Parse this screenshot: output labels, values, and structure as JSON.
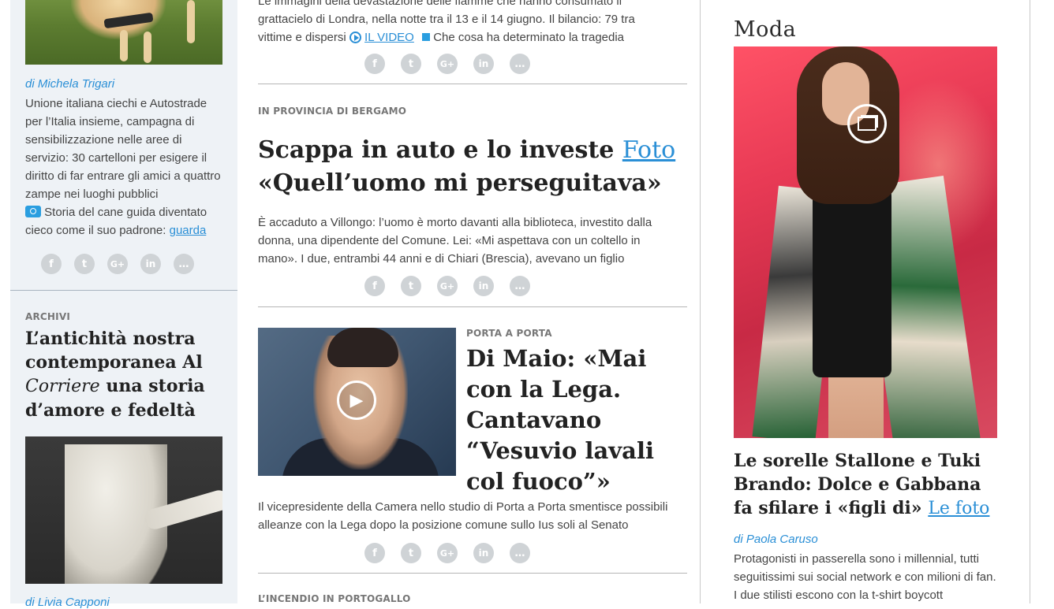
{
  "left": {
    "article1": {
      "byline_prefix": "di",
      "byline_name": "Michela Trigari",
      "body": "Unione italiana ciechi e Autostrade per l’Italia insieme, campagna di sensibilizzazione nelle aree di servizio: 30 cartelloni per esigere il diritto di far entrare gli amici a quattro zampe nei luoghi pubblici",
      "related_text": "Storia del cane guida diventato cieco come il suo padrone:",
      "related_link": "guarda"
    },
    "article2": {
      "section": "ARCHIVI",
      "title_part1": "L’antichità nostra contemporanea Al ",
      "title_italic": "Corriere",
      "title_part2": " una storia d’amore e fedeltà",
      "byline_prefix": "di",
      "byline_name": "Livia Capponi"
    }
  },
  "center": {
    "top_story": {
      "line1": "Le immagini della devastazione delle fiamme che hanno consumato il",
      "line2": "grattacielo di Londra, nella notte tra il 13 e il 14 giugno. Il bilancio: 79 tra",
      "line3_text": "vittime e dispersi",
      "video_label": "IL VIDEO",
      "related": "Che cosa ha determinato la tragedia"
    },
    "story2": {
      "section": "IN PROVINCIA DI BERGAMO",
      "title_line1": "Scappa in auto e lo investe",
      "title_link": "Foto",
      "title_line2": "«Quell’uomo mi perseguitava»",
      "body": "È accaduto a Villongo: l’uomo è morto davanti alla biblioteca, investito dalla donna, una dipendente del Comune. Lei: «Mi aspettava con un coltello in mano». I due, entrambi 44 anni e di Chiari (Brescia), avevano un figlio"
    },
    "story3": {
      "section": "PORTA A PORTA",
      "title": "Di Maio: «Mai con la Lega. Cantavano “Vesuvio lavali col fuoco”»",
      "body": "Il vicepresidente della Camera nello studio di Porta a Porta smentisce possibili alleanze con la Lega dopo la posizione comune sullo Ius soli al Senato"
    },
    "story4": {
      "section": "L’INCENDIO IN PORTOGALLO"
    }
  },
  "right": {
    "logo": "Moda",
    "title": "Le sorelle Stallone e Tuki Brando: Dolce e Gabbana fa sfilare i «figli di»",
    "title_link": "Le foto",
    "byline_prefix": "di",
    "byline_name": "Paola Caruso",
    "body": "Protagonisti in passerella sono i millennial, tutti seguitissimi sui social network e con milioni di fan. I due stilisti escono con la t-shirt boycott"
  },
  "social": {
    "facebook": "f",
    "twitter": "t",
    "googleplus": "G+",
    "linkedin": "in",
    "comment": "…"
  },
  "icons": [
    "facebook-icon",
    "twitter-icon",
    "googleplus-icon",
    "linkedin-icon",
    "comment-icon",
    "play-icon",
    "camera-icon",
    "gallery-icon"
  ],
  "colors": {
    "link": "#2a8fd6",
    "left_bg": "#eef2f6",
    "social_icon": "#cfd3d6"
  }
}
